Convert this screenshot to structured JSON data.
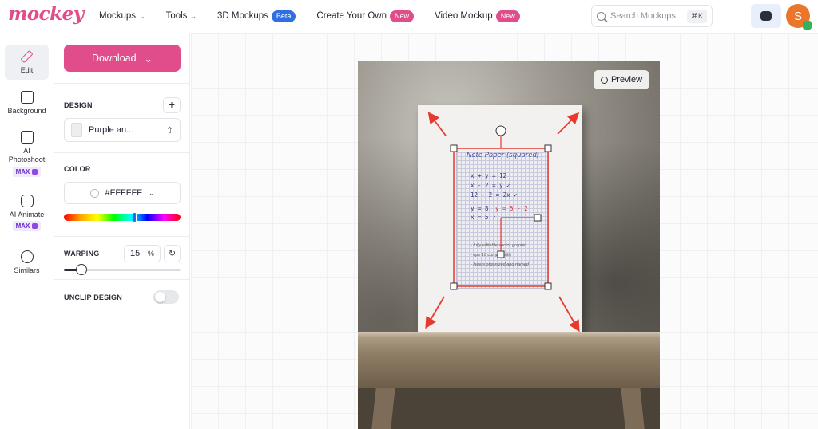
{
  "brand": {
    "logo_text": "mockey",
    "accent": "#e14d8a"
  },
  "nav": {
    "items": [
      {
        "label": "Mockups",
        "has_menu": true
      },
      {
        "label": "Tools",
        "has_menu": true
      },
      {
        "label": "3D Mockups",
        "badge": "Beta",
        "badge_color": "#2f6fe4"
      },
      {
        "label": "Create Your Own",
        "badge": "New",
        "badge_color": "#e14d8a"
      },
      {
        "label": "Video Mockup",
        "badge": "New",
        "badge_color": "#e14d8a"
      }
    ],
    "search": {
      "placeholder": "Search Mockups",
      "shortcut": "⌘K"
    },
    "avatar_letter": "S"
  },
  "rail": {
    "items": [
      {
        "label": "Edit",
        "icon": "pencil-icon",
        "active": true
      },
      {
        "label": "Background",
        "icon": "background-icon"
      },
      {
        "label": "AI Photoshoot",
        "icon": "ai-photoshoot-icon",
        "pill": "MAX"
      },
      {
        "label": "AI Animate",
        "icon": "ai-animate-icon",
        "pill": "MAX"
      },
      {
        "label": "Similars",
        "icon": "similars-icon"
      }
    ]
  },
  "panel": {
    "download_label": "Download",
    "design_label": "DESIGN",
    "design_name": "Purple an...",
    "color_label": "COLOR",
    "color_value": "#FFFFFF",
    "hue_position": 0.6,
    "warping_label": "WARPING",
    "warping_value": "15",
    "warping_unit": "%",
    "warping_fraction": 0.15,
    "unclip_label": "UNCLIP DESIGN",
    "unclip_on": false
  },
  "canvas": {
    "preview_label": "Preview",
    "note": {
      "title": "Note Paper (squared)",
      "lines": [
        "x + y = 12",
        "x - 2 = y ✓",
        "12 - 2 = 2x ✓",
        "y = 8",
        "x = 5 ✓"
      ],
      "red_line": "y = 5 - 2",
      "footer": [
        "- fully editable vector graphic",
        "- eps 10 compatibility",
        "- layers organized and named"
      ]
    }
  }
}
